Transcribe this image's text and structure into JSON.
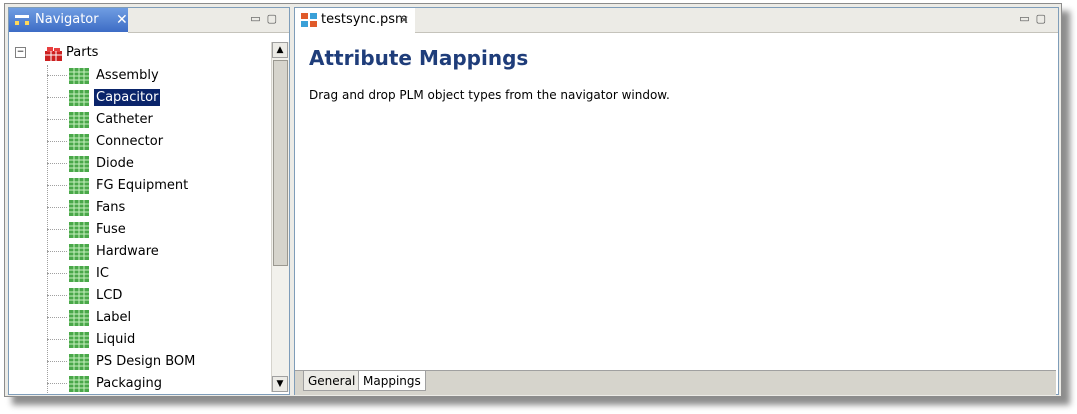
{
  "navigator": {
    "title": "Navigator",
    "close_label": "✕",
    "controls": [
      "▭",
      "▢"
    ],
    "root": {
      "expander": "−",
      "label": "Parts"
    },
    "items": [
      "Assembly",
      "Capacitor",
      "Catheter",
      "Connector",
      "Diode",
      "FG  Equipment",
      "Fans",
      "Fuse",
      "Hardware",
      "IC",
      "LCD",
      "Label",
      "Liquid",
      "PS Design BOM",
      "Packaging"
    ],
    "selected_item": "Capacitor"
  },
  "editor": {
    "tab_label": "testsync.psm",
    "tab_close": "✕",
    "controls": [
      "▭",
      "▢"
    ],
    "heading": "Attribute Mappings",
    "description": "Drag and drop PLM object types from the navigator window.",
    "bottom_tabs": [
      "General",
      "Mappings"
    ],
    "active_bottom_tab": "Mappings"
  },
  "scrollbar": {
    "up": "▲",
    "down": "▼"
  },
  "colors": {
    "selection": "#0a246a",
    "heading": "#1f3d7a",
    "active_view_tab": "#4a78d0"
  }
}
